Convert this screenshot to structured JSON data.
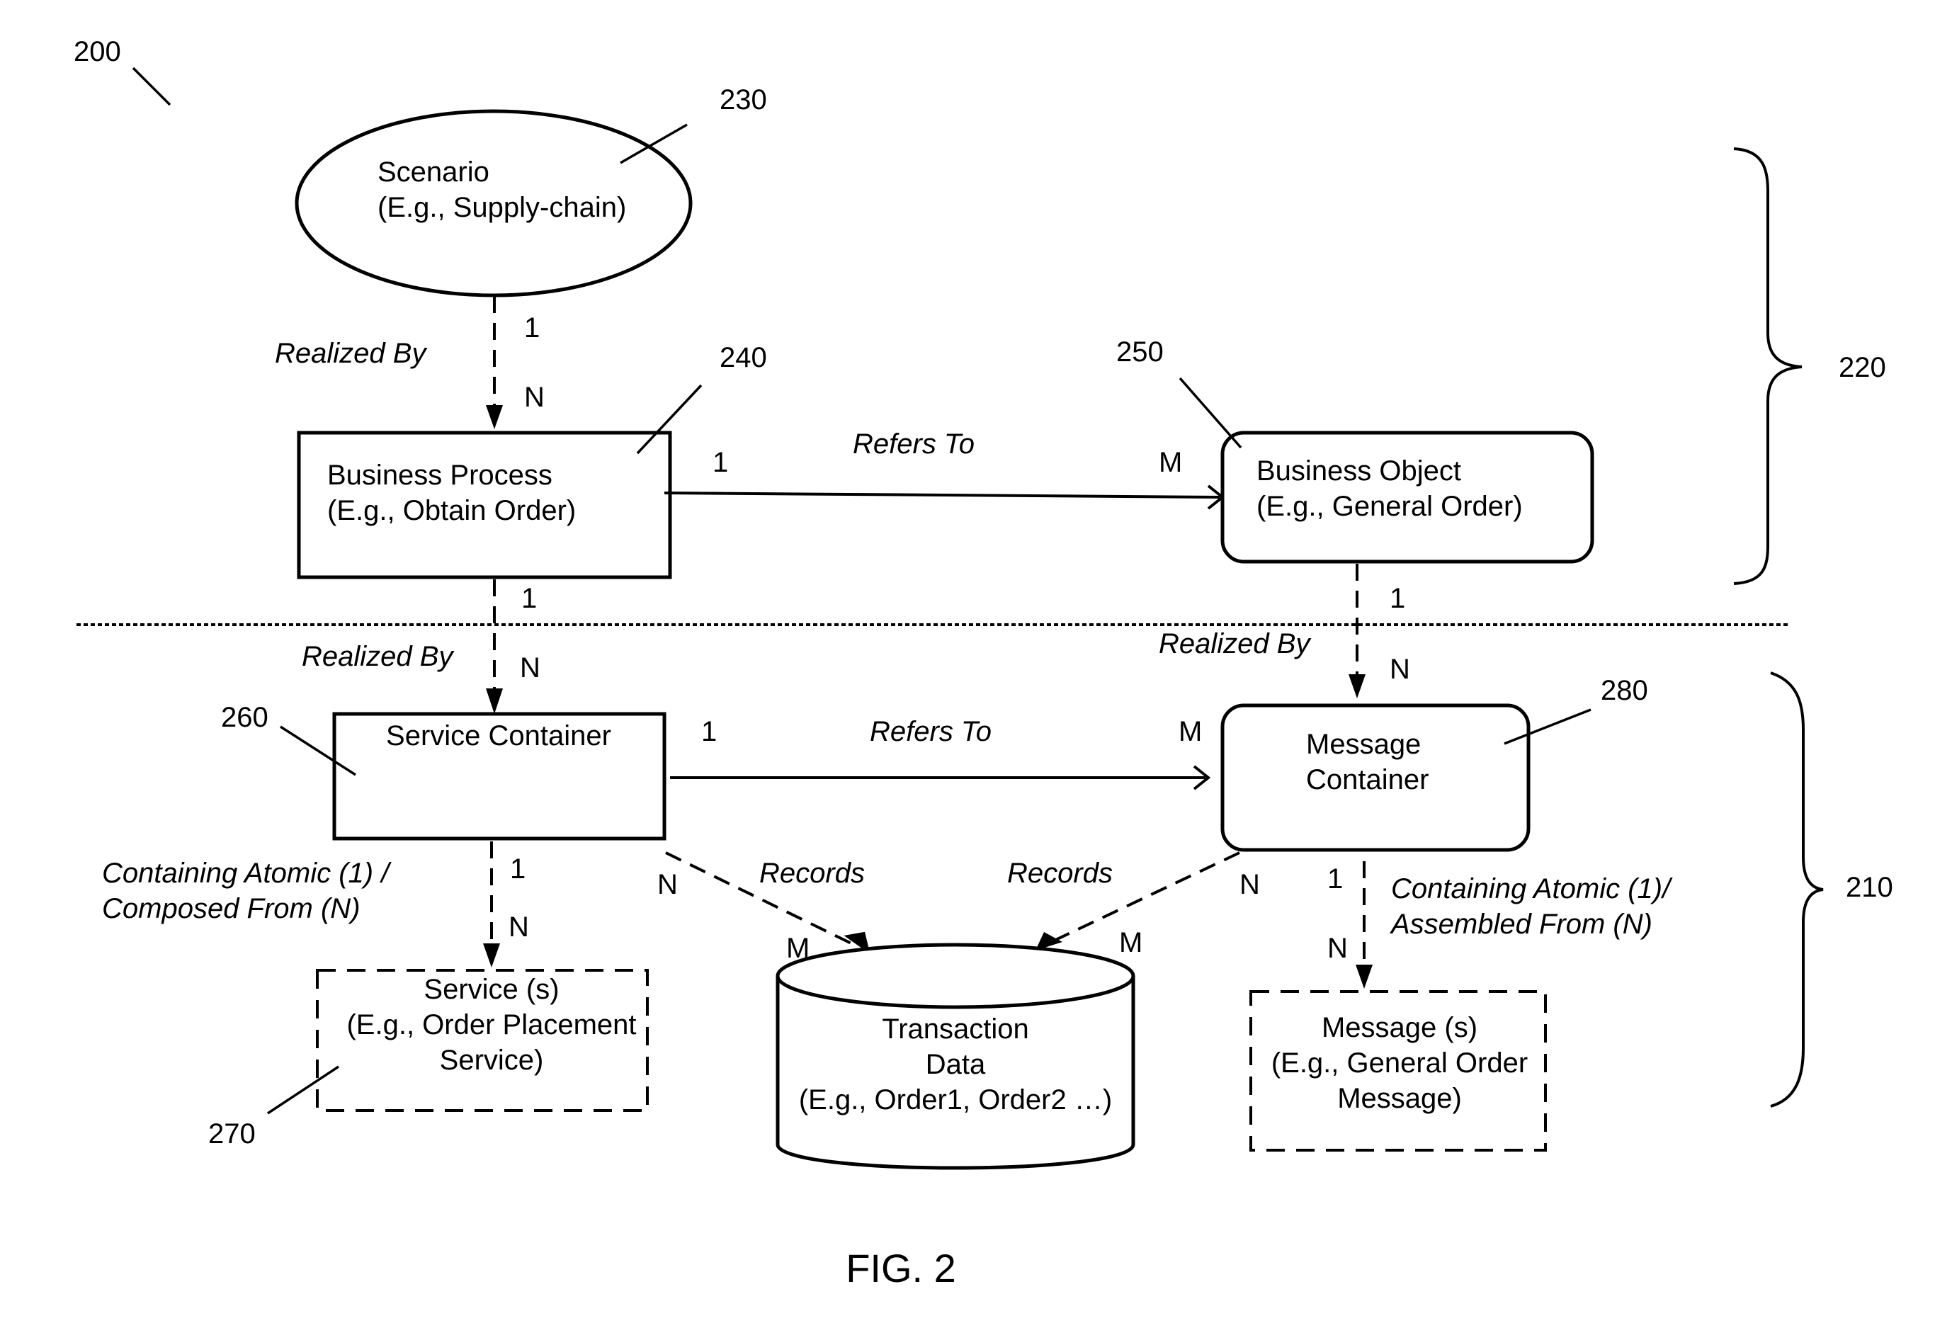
{
  "figure": {
    "title": "FIG. 2",
    "ref_number": "200"
  },
  "groups": [
    {
      "id": "upper",
      "ref": "220"
    },
    {
      "id": "lower",
      "ref": "210"
    }
  ],
  "nodes": {
    "scenario": {
      "ref": "230",
      "lines": [
        "Scenario",
        "(E.g., Supply-chain)"
      ],
      "shape": "ellipse"
    },
    "business_process": {
      "ref": "240",
      "lines": [
        "Business Process",
        "(E.g., Obtain Order)"
      ],
      "shape": "rectangle"
    },
    "business_object": {
      "ref": "250",
      "lines": [
        "Business Object",
        "(E.g., General Order)"
      ],
      "shape": "rounded-rectangle"
    },
    "service_container": {
      "ref": "260",
      "lines": [
        "Service Container"
      ],
      "shape": "rectangle"
    },
    "services": {
      "ref": "270",
      "lines": [
        "Service (s)",
        "(E.g., Order Placement",
        "Service)"
      ],
      "shape": "dashed-rectangle"
    },
    "message_container": {
      "ref": "280",
      "lines": [
        "Message",
        "Container"
      ],
      "shape": "rounded-rectangle"
    },
    "transaction_data": {
      "lines": [
        "Transaction",
        "Data",
        "(E.g., Order1, Order2 …)"
      ],
      "shape": "cylinder"
    },
    "messages": {
      "lines": [
        "Message (s)",
        "(E.g., General Order",
        "Message)"
      ],
      "shape": "dashed-rectangle"
    }
  },
  "edges": {
    "scenario_to_bp": {
      "label": "Realized By",
      "from_card": "1",
      "to_card": "N"
    },
    "bp_to_bo": {
      "label": "Refers To",
      "from_card": "1",
      "to_card": "M"
    },
    "bp_to_sc": {
      "label": "Realized By",
      "from_card": "1",
      "to_card": "N"
    },
    "bo_to_mc": {
      "label": "Realized By",
      "from_card": "1",
      "to_card": "N"
    },
    "sc_to_mc": {
      "label": "Refers To",
      "from_card": "1",
      "to_card": "M"
    },
    "sc_to_services": {
      "label_lines": [
        "Containing Atomic (1) /",
        "Composed From (N)"
      ],
      "from_card": "1",
      "to_card": "N"
    },
    "sc_to_td": {
      "label": "Records",
      "from_card": "N",
      "to_card": "M"
    },
    "mc_to_td": {
      "label": "Records",
      "from_card": "N",
      "to_card": "M"
    },
    "mc_to_messages": {
      "label_lines": [
        "Containing Atomic (1)/",
        "Assembled From (N)"
      ],
      "from_card": "1",
      "to_card": "N"
    }
  }
}
